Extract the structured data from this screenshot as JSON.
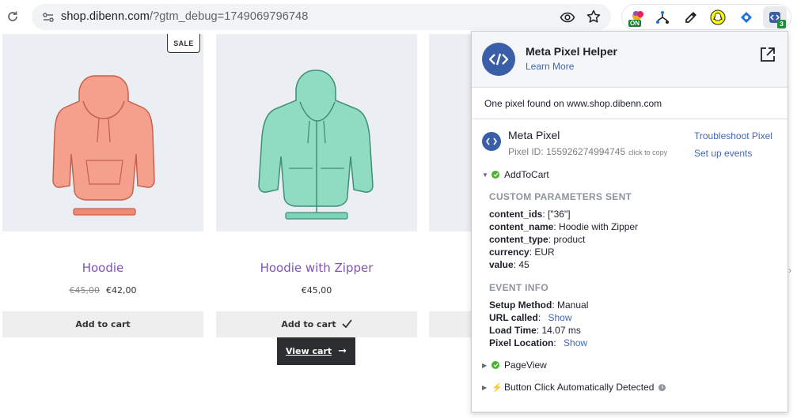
{
  "browser": {
    "url_host": "shop.dibenn.com",
    "url_rest": "/?gtm_debug=1749069796748",
    "extensions": {
      "on_badge": "ON",
      "meta_count": "3"
    }
  },
  "shop": {
    "sale_badge": "SALE",
    "products": [
      {
        "name": "Hoodie",
        "old_price": "€45,00",
        "price": "€42,00",
        "button": "Add to cart"
      },
      {
        "name": "Hoodie with Zipper",
        "price": "€45,00",
        "button": "Add to cart"
      }
    ],
    "view_cart": "View cart"
  },
  "popup": {
    "title": "Meta Pixel Helper",
    "learn_more": "Learn More",
    "found_text": "One pixel found on www.shop.dibenn.com",
    "pixel": {
      "name": "Meta Pixel",
      "id_label": "Pixel ID: 155926274994745",
      "click_to_copy": "click to copy",
      "troubleshoot": "Troubleshoot Pixel",
      "setup_events": "Set up events"
    },
    "events": [
      {
        "name": "AddToCart",
        "status": "success",
        "expanded": true
      },
      {
        "name": "PageView",
        "status": "success",
        "expanded": false
      },
      {
        "name": "Button Click Automatically Detected",
        "status": "automatic",
        "expanded": false
      }
    ],
    "custom_params_title": "CUSTOM PARAMETERS SENT",
    "custom_params": [
      {
        "key": "content_ids",
        "value": "[\"36\"]"
      },
      {
        "key": "content_name",
        "value": "Hoodie with Zipper"
      },
      {
        "key": "content_type",
        "value": "product"
      },
      {
        "key": "currency",
        "value": "EUR"
      },
      {
        "key": "value",
        "value": "45"
      }
    ],
    "event_info_title": "EVENT INFO",
    "event_info": [
      {
        "key": "Setup Method",
        "value": "Manual"
      },
      {
        "key": "URL called",
        "link": "Show"
      },
      {
        "key": "Load Time",
        "value": "14.07 ms"
      },
      {
        "key": "Pixel Location",
        "link": "Show"
      }
    ]
  },
  "colors": {
    "brand_purple": "#7f54b3",
    "meta_blue": "#3b5ea9",
    "link_blue": "#4267b2",
    "success_green": "#42b72a"
  }
}
